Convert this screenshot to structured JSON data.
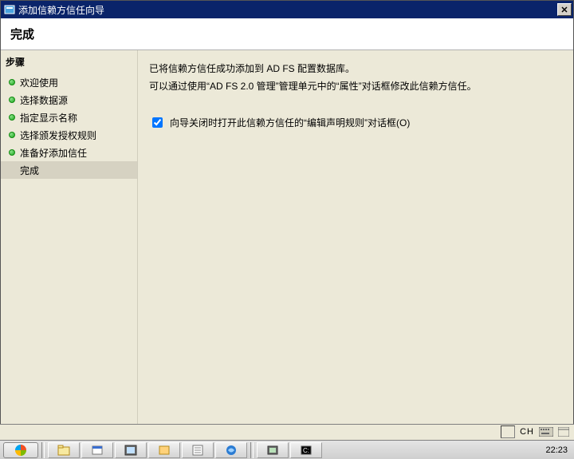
{
  "window": {
    "title": "添加信赖方信任向导",
    "banner_title": "完成"
  },
  "sidebar": {
    "heading": "步骤",
    "items": [
      {
        "label": "欢迎使用"
      },
      {
        "label": "选择数据源"
      },
      {
        "label": "指定显示名称"
      },
      {
        "label": "选择颁发授权规则"
      },
      {
        "label": "准备好添加信任"
      },
      {
        "label": "完成"
      }
    ],
    "selected_index": 5
  },
  "content": {
    "line1": "已将信赖方信任成功添加到 AD FS 配置数据库。",
    "line2": "可以通过使用“AD FS 2.0 管理”管理单元中的“属性”对话框修改此信赖方信任。",
    "checkbox_label": "向导关闭时打开此信赖方信任的“编辑声明规则”对话框(O)",
    "checkbox_checked": true
  },
  "lang_indicator": "CH",
  "clock": "22:23"
}
